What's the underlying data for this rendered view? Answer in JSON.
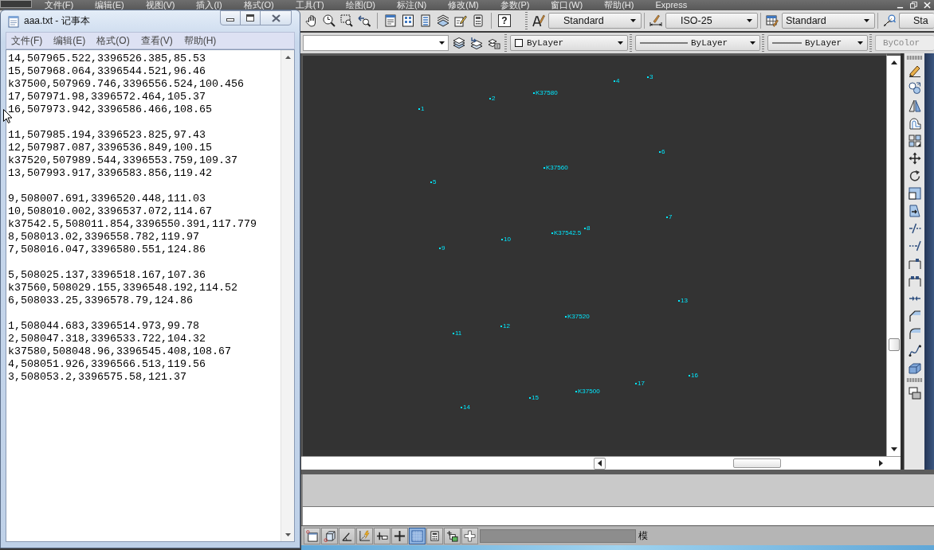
{
  "cad_menu": [
    "文件(F)",
    "编辑(E)",
    "视图(V)",
    "插入(I)",
    "格式(O)",
    "工具(T)",
    "绘图(D)",
    "标注(N)",
    "修改(M)",
    "参数(P)",
    "窗口(W)",
    "帮助(H)",
    "Express"
  ],
  "notepad": {
    "title": "aaa.txt - 记事本",
    "menu": [
      "文件(F)",
      "编辑(E)",
      "格式(O)",
      "查看(V)",
      "帮助(H)"
    ],
    "paragraphs": [
      [
        "14,507965.522,3396526.385,85.53",
        "15,507968.064,3396544.521,96.46",
        "k37500,507969.746,3396556.524,100.456",
        "17,507971.98,3396572.464,105.37",
        "16,507973.942,3396586.466,108.65"
      ],
      [
        "11,507985.194,3396523.825,97.43",
        "12,507987.087,3396536.849,100.15",
        "k37520,507989.544,3396553.759,109.37",
        "13,507993.917,3396583.856,119.42"
      ],
      [
        "9,508007.691,3396520.448,111.03",
        "10,508010.002,3396537.072,114.67",
        "k37542.5,508011.854,3396550.391,117.779",
        "8,508013.02,3396558.782,119.97",
        "7,508016.047,3396580.551,124.86"
      ],
      [
        "5,508025.137,3396518.167,107.36",
        "k37560,508029.155,3396548.192,114.52",
        "6,508033.25,3396578.79,124.86"
      ],
      [
        "1,508044.683,3396514.973,99.78",
        "2,508047.318,3396533.722,104.32",
        "k37580,508048.96,3396545.408,108.67",
        "4,508051.926,3396566.513,119.56",
        "3,508053.2,3396575.58,121.37"
      ]
    ]
  },
  "help_button": "?",
  "styles_toolbar": [
    {
      "kind": "text_style",
      "value": "Standard"
    },
    {
      "kind": "dimension_style",
      "value": "ISO-25"
    },
    {
      "kind": "table_style",
      "value": "Standard"
    },
    {
      "kind": "leader_style",
      "value": "Sta"
    }
  ],
  "properties_toolbar": [
    {
      "kind": "color",
      "value": "ByLayer",
      "disabled": false
    },
    {
      "kind": "linetype",
      "value": "ByLayer",
      "disabled": false
    },
    {
      "kind": "lineweight",
      "value": "ByLayer",
      "disabled": false
    },
    {
      "kind": "plot_style",
      "value": "ByColor",
      "disabled": true
    }
  ],
  "canvas": {
    "points": [
      {
        "label": "3"
      },
      {
        "label": "4"
      },
      {
        "label": "K37580"
      },
      {
        "label": "2"
      },
      {
        "label": "1"
      },
      {
        "label": "6"
      },
      {
        "label": "K37560"
      },
      {
        "label": "5"
      },
      {
        "label": "7"
      },
      {
        "label": "8"
      },
      {
        "label": "K37542.5"
      },
      {
        "label": "10"
      },
      {
        "label": "9"
      },
      {
        "label": "13"
      },
      {
        "label": "K37520"
      },
      {
        "label": "12"
      },
      {
        "label": "11"
      },
      {
        "label": "16"
      },
      {
        "label": "17"
      },
      {
        "label": "K37500"
      },
      {
        "label": "15"
      },
      {
        "label": "14"
      }
    ]
  },
  "status_bar": {
    "toggles": [
      {
        "on": false
      },
      {
        "on": false
      },
      {
        "on": false
      },
      {
        "on": false
      },
      {
        "on": false
      },
      {
        "on": false
      },
      {
        "on": true
      },
      {
        "on": false
      },
      {
        "on": false
      },
      {
        "on": false
      }
    ],
    "text": "模"
  }
}
